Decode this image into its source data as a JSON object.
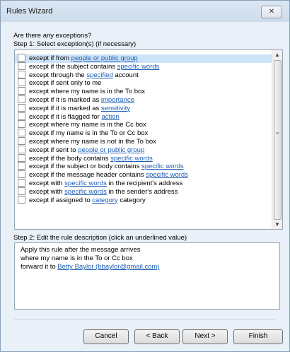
{
  "window": {
    "title": "Rules Wizard",
    "close_icon": "close-icon"
  },
  "prompt": "Are there any exceptions?",
  "step1": "Step 1: Select exception(s) (if necessary)",
  "exceptions": [
    [
      {
        "t": "except if from "
      },
      {
        "t": "people or public group",
        "link": true
      }
    ],
    [
      {
        "t": "except if the subject contains "
      },
      {
        "t": "specific words",
        "link": true
      }
    ],
    [
      {
        "t": "except through the "
      },
      {
        "t": "specified",
        "link": true
      },
      {
        "t": " account"
      }
    ],
    [
      {
        "t": "except if sent only to me"
      }
    ],
    [
      {
        "t": "except where my name is in the To box"
      }
    ],
    [
      {
        "t": "except if it is marked as "
      },
      {
        "t": "importance",
        "link": true
      }
    ],
    [
      {
        "t": "except if it is marked as "
      },
      {
        "t": "sensitivity",
        "link": true
      }
    ],
    [
      {
        "t": "except if it is flagged for "
      },
      {
        "t": "action",
        "link": true
      }
    ],
    [
      {
        "t": "except where my name is in the Cc box"
      }
    ],
    [
      {
        "t": "except if my name is in the To or Cc box"
      }
    ],
    [
      {
        "t": "except where my name is not in the To box"
      }
    ],
    [
      {
        "t": "except if sent to "
      },
      {
        "t": "people or public group",
        "link": true
      }
    ],
    [
      {
        "t": "except if the body contains "
      },
      {
        "t": "specific words",
        "link": true
      }
    ],
    [
      {
        "t": "except if the subject or body contains "
      },
      {
        "t": "specific words",
        "link": true
      }
    ],
    [
      {
        "t": "except if the message header contains "
      },
      {
        "t": "specific words",
        "link": true
      }
    ],
    [
      {
        "t": "except with "
      },
      {
        "t": "specific words",
        "link": true
      },
      {
        "t": " in the recipient's address"
      }
    ],
    [
      {
        "t": "except with "
      },
      {
        "t": "specific words",
        "link": true
      },
      {
        "t": " in the sender's address"
      }
    ],
    [
      {
        "t": "except if assigned to "
      },
      {
        "t": "category",
        "link": true
      },
      {
        "t": " category"
      }
    ]
  ],
  "selected_index": 0,
  "step2": "Step 2: Edit the rule description (click an underlined value)",
  "description": [
    [
      {
        "t": "Apply this rule after the message arrives"
      }
    ],
    [
      {
        "t": "where my name is in the To or Cc box"
      }
    ],
    [
      {
        "t": "forward it to "
      },
      {
        "t": "Betty Baylor (bbaylor@gmail.com)",
        "link": true
      }
    ]
  ],
  "buttons": {
    "cancel": "Cancel",
    "back": "< Back",
    "next": "Next >",
    "finish": "Finish"
  },
  "colors": {
    "link": "#1f5fb5",
    "selected_row": "#cde3f8"
  }
}
